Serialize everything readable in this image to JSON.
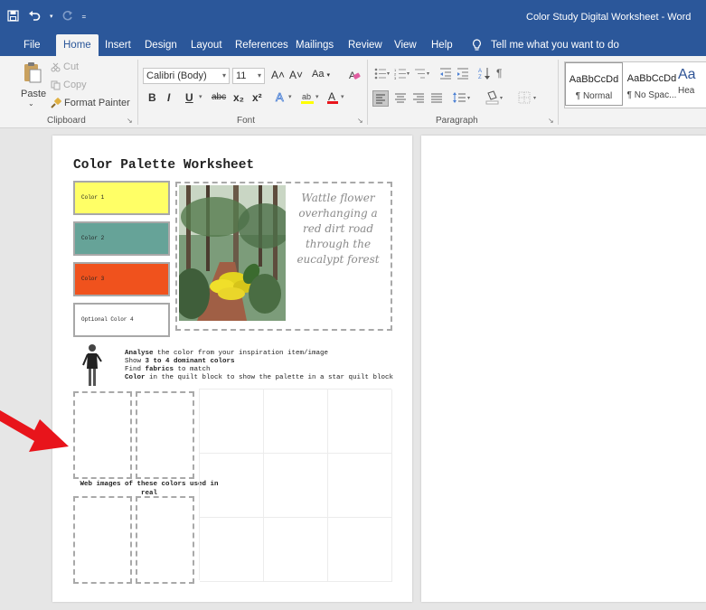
{
  "window": {
    "title": "Color Study Digital Worksheet - Word"
  },
  "quick_access": {
    "save_icon": "save-icon",
    "undo_icon": "undo-icon",
    "redo_icon": "redo-icon",
    "customize_icon": "customize-icon"
  },
  "tabs": [
    "File",
    "Home",
    "Insert",
    "Design",
    "Layout",
    "References",
    "Mailings",
    "Review",
    "View",
    "Help"
  ],
  "active_tab": "Home",
  "tell_me": "Tell me what you want to do",
  "clipboard": {
    "paste": "Paste",
    "cut": "Cut",
    "copy": "Copy",
    "format_painter": "Format Painter",
    "label": "Clipboard"
  },
  "font": {
    "name": "Calibri (Body)",
    "size": "11",
    "label": "Font",
    "bold": "B",
    "italic": "I",
    "underline": "U",
    "strike": "abc",
    "subscript": "x₂",
    "superscript": "x²",
    "grow": "A˄",
    "shrink": "A˅",
    "case": "Aa"
  },
  "paragraph": {
    "label": "Paragraph"
  },
  "styles": {
    "normal_sample": "AaBbCcDd",
    "normal_label": "¶ Normal",
    "nospace_sample": "AaBbCcDd",
    "nospace_label": "¶ No Spac...",
    "heading_sample": "Aa",
    "heading_label": "Hea"
  },
  "colors": {
    "title_bar": "#2b579a",
    "ribbon": "#f3f3f3",
    "workspace": "#e6e6e6",
    "color1": "#ffff66",
    "color2": "#66a398",
    "color3": "#f0521d",
    "optional": "#ffffff",
    "arrow": "#e8141b"
  },
  "worksheet": {
    "title": "Color Palette Worksheet",
    "swatches": [
      "Color 1",
      "Color 2",
      "Color 3",
      "Optional Color 4"
    ],
    "photo_caption": "Wattle flower overhanging a red dirt road through the eucalypt forest",
    "instructions": [
      {
        "bold": "Analyse",
        "rest": " the color from your inspiration item/image"
      },
      {
        "plain": "Show ",
        "bold": "3 to 4 dominant colors",
        "rest": ""
      },
      {
        "plain": "Find ",
        "bold": "fabrics",
        "rest": " to match"
      },
      {
        "bold": "Color",
        "rest": " in the quilt block to show the palette in a star quilt block"
      }
    ],
    "web_images_label": "Web images of these colors used in real"
  }
}
